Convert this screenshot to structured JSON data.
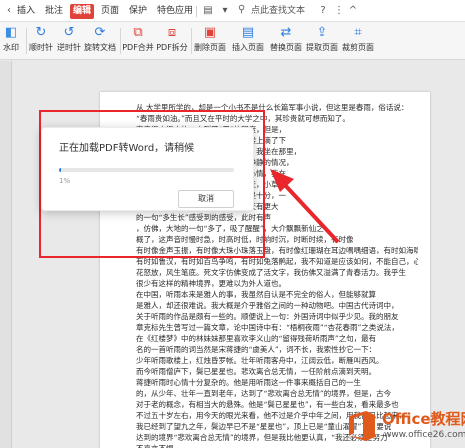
{
  "menu": {
    "tabs": [
      "插入",
      "批注",
      "编辑",
      "页面",
      "保护",
      "特色应用"
    ],
    "active_index": 2,
    "search_label": "点此查找文本"
  },
  "ribbon": {
    "buttons": [
      {
        "label": "水印",
        "icon": "watermark-icon"
      },
      {
        "label": "顺时针",
        "icon": "rotate-clockwise-icon"
      },
      {
        "label": "逆时针",
        "icon": "rotate-counterclockwise-icon"
      },
      {
        "label": "旋转文档",
        "icon": "rotate-document-icon"
      },
      {
        "label": "PDF合并",
        "icon": "pdf-merge-icon"
      },
      {
        "label": "PDF拆分",
        "icon": "pdf-split-icon"
      },
      {
        "label": "删除页面",
        "icon": "delete-page-icon"
      },
      {
        "label": "插入页面",
        "icon": "insert-page-icon"
      },
      {
        "label": "替换页面",
        "icon": "replace-page-icon"
      },
      {
        "label": "提取页面",
        "icon": "extract-page-icon"
      },
      {
        "label": "裁剪页面",
        "icon": "crop-page-icon"
      }
    ]
  },
  "dialog": {
    "title": "正在加载PDF转Word，请稍候",
    "progress_percent": 1,
    "progress_label": "1%",
    "cancel_label": "取消"
  },
  "document": {
    "lines": [
      "从 大学里所学的，却是一个小书不是什么长篇军事小说，但这里是春雨，俗话说：",
      "“春雨贵如油。”而且又在平时的大学之中，其珍贵就可想而知了。",
      "                                                    声音很小很小的，小到了“无”的程度，但是，",
      "                                                    厉的。这里，现在正有大块铁皮，楼上滴了下",
      "                                                    于是就不再“细无声”了。按常理说，我坐在那里，",
      "                                                    就是这么我，我的心是在惦念土地静静的情况，",
      "                                                    了，仿佛静静地倾听，根静根静的心情，我在",
      "                                                    静静以上，一直几乎就是比比一下天，小草在",
      "                                                    个出来的。这种雨放铁皮的声音就是十分，一",
      "                                                    得静静地伸开和那里，所以雨声一天有更大",
      "                                                    的一句“多生长”感受到的感受，此时有声",
      "                                                    ，仿佛，大地的一句“多了，吸了醒醒”，大介飘飘新仙之",
      "        概了，这声音时慢时急，时高时低，时响时沉，时断时续，有时像",
      "有时像金声玉振，有时像大珠小珠落玉盘，有时像红珊瑚在耳边喁喁细语，有时如海啸",
      "有时如鲁汉，有时如百鸟争鸣，有时如兔落鹘起，我不知道是应该如何，不能自己，心",
      "花怒放，风生笔底。死文字仿佛变成了活文字，我仿佛又溢满了青春活力。我乎生",
      "很少有这样的精神境界，更难以为外人道也。",
      "    在中国，听雨本来是雅人的事，我虽然自认是不完全的俗人，但能够就算",
      "是雅人，却还很难说。我大概是介乎雅俗之间的一种动物吧。中国古代诗词中，",
      "关于听雨的作品是颇有一些的。顺便说上一句：外国诗词中似乎少见。我的朋友",
      "章克标先生曾写过一篇文章，论中国诗中有：“梧桐夜雨”“杏花春雨”之类说法，",
      "在《红楼梦》中的林妹妹那里喜欢李义山的“留得残荷听雨声”之句，最有",
      "名的一首听雨的词当然是宋蒋捷的“虞美人”，词不长，我索性抄它一下：",
      "        少年听雨歌楼上，红烛昏罗帐。壮年听雨客舟中，江阔云低，断雁叫西风。",
      "    而今听雨僧庐下，鬓已星星也。悲欢离合总无情，一任阶前点滴到天明。",
      "    蒋捷听雨时心情十分复杂的。他是用听雨这一件事来概括自己的一生",
      "的，从少年、壮年一直到老年，达到了“悲欢离合总无情”的境界，但是，古今",
      "对于老的概念，有相当大的悬殊。他是“鬓已星星也”，有一些白发，看来最多也",
      "不过五十岁左右，用今天的眼光来看，他不过是介乎中年之间，用我自己比起来，",
      "我已经到了望九之年，鬓边早已不是“星星也”，顶上已是“童山濯濯”了。要说",
      "达到的境界“悲欢离合总无情”的境界，但是我比他更认真，“我还必须更努力”",
      "不喜亦不惧"
    ]
  },
  "watermark": {
    "brand": "Office教程网",
    "url": "www.office26.com"
  },
  "colors": {
    "active_tab": "#e0433a",
    "annotation_red": "#e8262b",
    "progress_blue": "#2f7de1",
    "watermark_orange": "#e05a1c"
  }
}
